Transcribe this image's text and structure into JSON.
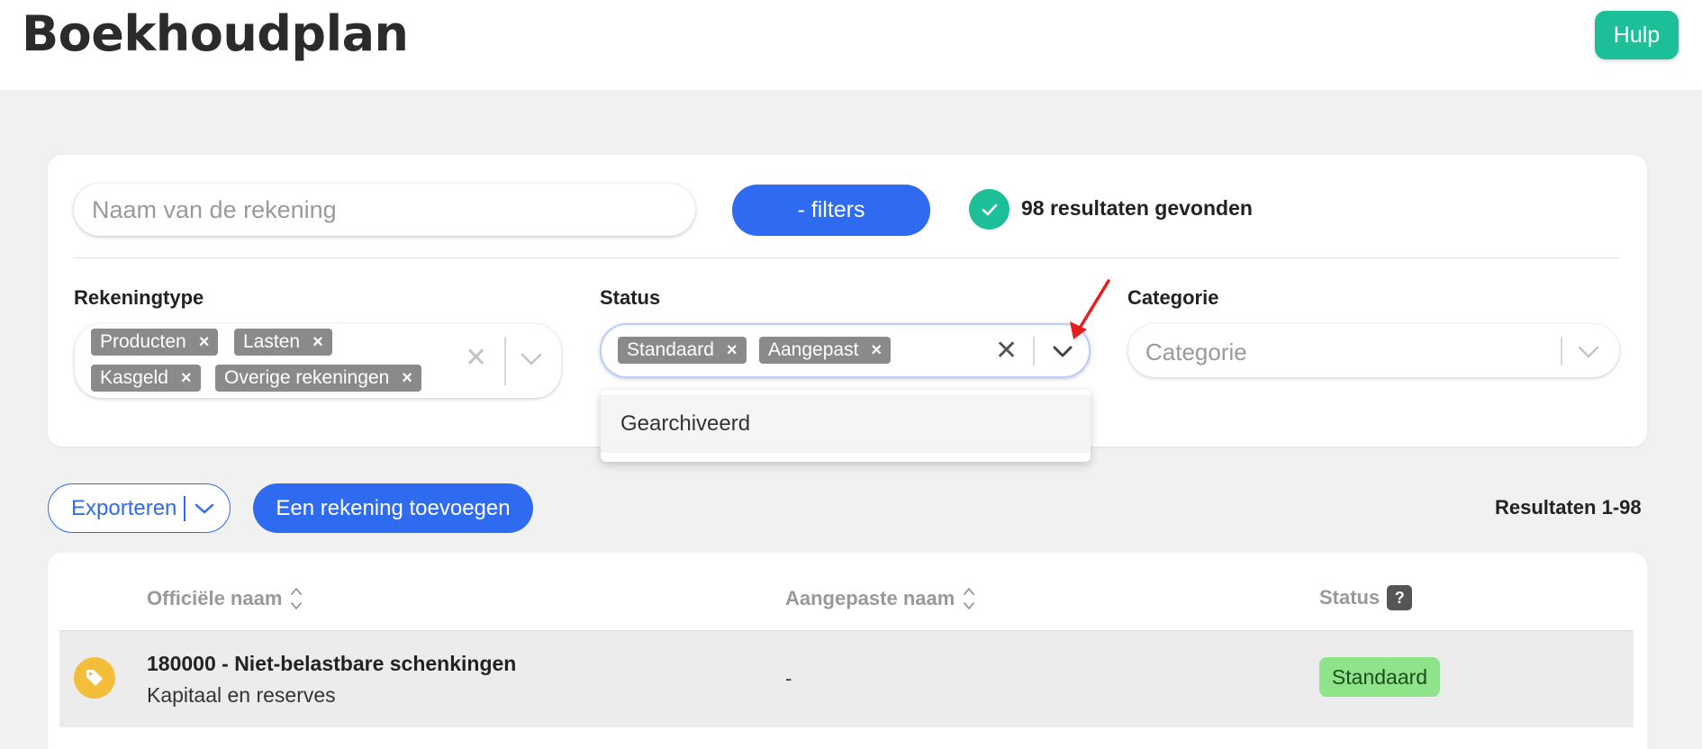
{
  "header": {
    "title": "Boekhoudplan",
    "help_label": "Hulp"
  },
  "search": {
    "placeholder": "Naam van de rekening"
  },
  "filters_button": "- filters",
  "results_found": "98 resultaten gevonden",
  "filters": {
    "account_type": {
      "label": "Rekeningtype",
      "chips": [
        "Producten",
        "Lasten",
        "Kasgeld",
        "Overige rekeningen"
      ]
    },
    "status": {
      "label": "Status",
      "chips": [
        "Standaard",
        "Aangepast"
      ],
      "dropdown_options": [
        "Gearchiveerd"
      ]
    },
    "category": {
      "label": "Categorie",
      "placeholder": "Categorie"
    }
  },
  "actions": {
    "export_label": "Exporteren",
    "add_label": "Een rekening toevoegen",
    "results_range": "Resultaten 1-98"
  },
  "table": {
    "columns": [
      "Officiële naam",
      "Aangepaste naam",
      "Status"
    ],
    "help_mark": "?",
    "rows": [
      {
        "official_name": "180000 - Niet-belastbare schenkingen",
        "subtitle": "Kapitaal en reserves",
        "custom_name": "-",
        "status": "Standaard"
      }
    ]
  },
  "colors": {
    "primary": "#2f6bf0",
    "accent": "#1dbf99",
    "chip": "#8a8a8a",
    "status_standard": "#8fe38b",
    "tag_icon": "#f5be3a"
  }
}
